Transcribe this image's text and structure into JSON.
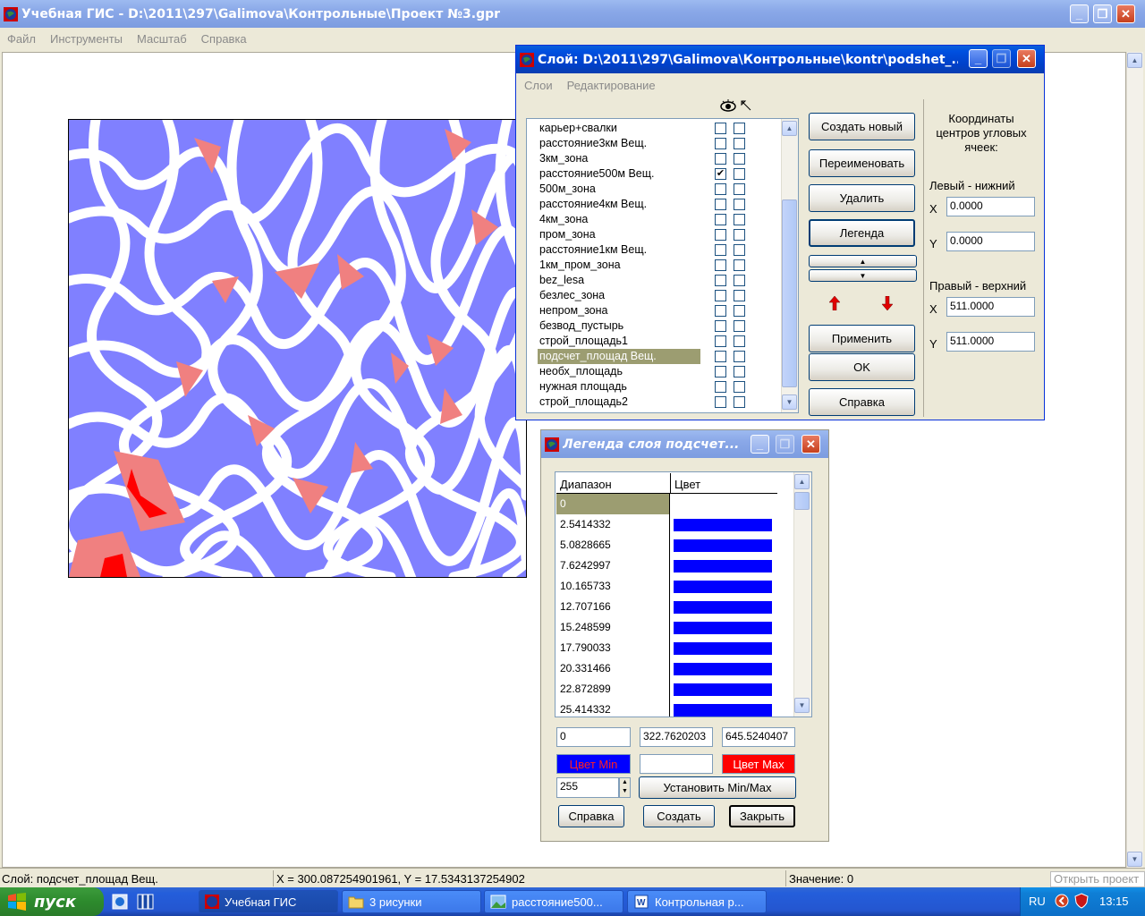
{
  "main_window": {
    "title": "Учебная ГИС - D:\\2011\\297\\Galimova\\Контрольные\\Проект №3.gpr",
    "menu": [
      "Файл",
      "Инструменты",
      "Масштаб",
      "Справка"
    ]
  },
  "layer_dialog": {
    "title": "Слой: D:\\2011\\297\\Galimova\\Контрольные\\kontr\\podshet_...",
    "menu": [
      "Слои",
      "Редактирование"
    ],
    "layers": [
      {
        "name": "карьер+свалки",
        "visible": false
      },
      {
        "name": "расстояние3км Вещ.",
        "visible": false
      },
      {
        "name": "3км_зона",
        "visible": false
      },
      {
        "name": "расстояние500м Вещ.",
        "visible": true
      },
      {
        "name": "500м_зона",
        "visible": false
      },
      {
        "name": "расстояние4км Вещ.",
        "visible": false
      },
      {
        "name": "4км_зона",
        "visible": false
      },
      {
        "name": "пром_зона",
        "visible": false
      },
      {
        "name": "расстояние1км Вещ.",
        "visible": false
      },
      {
        "name": "1км_пром_зона",
        "visible": false
      },
      {
        "name": "bez_lesa",
        "visible": false
      },
      {
        "name": "безлес_зона",
        "visible": false
      },
      {
        "name": "непром_зона",
        "visible": false
      },
      {
        "name": "безвод_пустырь",
        "visible": false
      },
      {
        "name": "строй_площадь1",
        "visible": false
      },
      {
        "name": "подсчет_площад Вещ.",
        "visible": false,
        "selected": true
      },
      {
        "name": "необх_площадь",
        "visible": false
      },
      {
        "name": "нужная площадь",
        "visible": false
      },
      {
        "name": "строй_площадь2",
        "visible": false
      }
    ],
    "buttons": {
      "create": "Создать новый",
      "rename": "Переименовать",
      "delete": "Удалить",
      "legend": "Легенда",
      "apply": "Применить",
      "ok": "OK",
      "help": "Справка"
    },
    "coords": {
      "heading": "Координаты центров угловых ячеек:",
      "lower_left_label": "Левый - нижний",
      "upper_right_label": "Правый - верхний",
      "x_label": "X",
      "y_label": "Y",
      "ll_x": "0.0000",
      "ll_y": "0.0000",
      "ur_x": "511.0000",
      "ur_y": "511.0000"
    }
  },
  "legend_dialog": {
    "title": "Легенда слоя подсчет...",
    "col_range": "Диапазон",
    "col_color": "Цвет",
    "rows": [
      {
        "value": "0",
        "color": "#ffffff",
        "selected": true
      },
      {
        "value": "2.5414332",
        "color": "#0000ff"
      },
      {
        "value": "5.0828665",
        "color": "#0000ff"
      },
      {
        "value": "7.6242997",
        "color": "#0000ff"
      },
      {
        "value": "10.165733",
        "color": "#0000ff"
      },
      {
        "value": "12.707166",
        "color": "#0000ff"
      },
      {
        "value": "15.248599",
        "color": "#0000ff"
      },
      {
        "value": "17.790033",
        "color": "#0000ff"
      },
      {
        "value": "20.331466",
        "color": "#0000ff"
      },
      {
        "value": "22.872899",
        "color": "#0000ff"
      },
      {
        "value": "25.414332",
        "color": "#0000ff"
      }
    ],
    "min_value": "0",
    "mid_value": "322.7620203",
    "max_value": "645.5240407",
    "color_min_label": "Цвет Min",
    "color_max_label": "Цвет Max",
    "color_min": "#0000ff",
    "color_max": "#ff0000",
    "steps": "255",
    "set_minmax": "Установить Min/Max",
    "help": "Справка",
    "create": "Создать",
    "close": "Закрыть"
  },
  "status_bar": {
    "layer": "Слой: подсчет_площад  Вещ.",
    "coords": "X = 300.087254901961, Y = 17.5343137254902",
    "value": "Значение: 0",
    "tooltip": "Открыть проект"
  },
  "taskbar": {
    "start": "пуск",
    "items": [
      "Учебная ГИС",
      "3 рисунки",
      "расстояние500...",
      "Контрольная р..."
    ],
    "lang": "RU",
    "clock": "13:15"
  },
  "colors": {
    "map_blue": "#8080ff",
    "map_pink": "#f08080",
    "map_red": "#ff0000",
    "selection": "#9c9d71"
  }
}
